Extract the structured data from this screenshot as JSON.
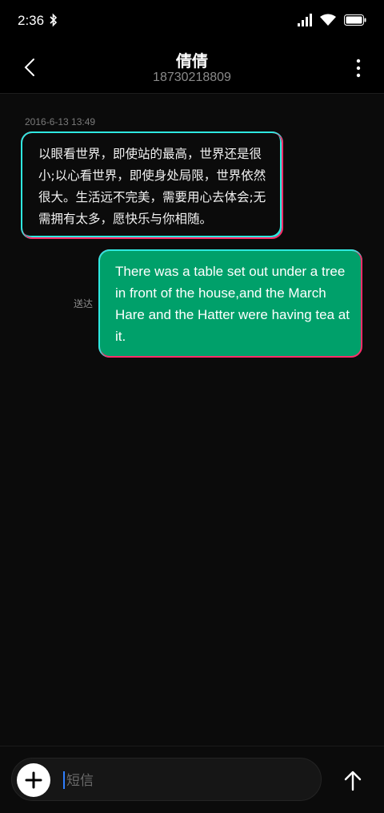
{
  "status_bar": {
    "time": "2:36"
  },
  "header": {
    "title": "倩倩",
    "subtitle": "18730218809"
  },
  "conversation": {
    "timestamp": "2016-6-13 13:49",
    "incoming_message": "以眼看世界，即使站的最高，世界还是很小;以心看世界，即使身处局限，世界依然很大。生活远不完美，需要用心去体会;无需拥有太多，愿快乐与你相随。",
    "outgoing_message": "There was a table set out under a tree in front of the house,and the March Hare and the Hatter were having tea at it.",
    "outgoing_status": "送达"
  },
  "composer": {
    "placeholder": "短信"
  },
  "colors": {
    "outgoing_bubble": "#00a06a",
    "accent_cyan": "#2ee8e0",
    "accent_pink": "#ff2d6a"
  }
}
